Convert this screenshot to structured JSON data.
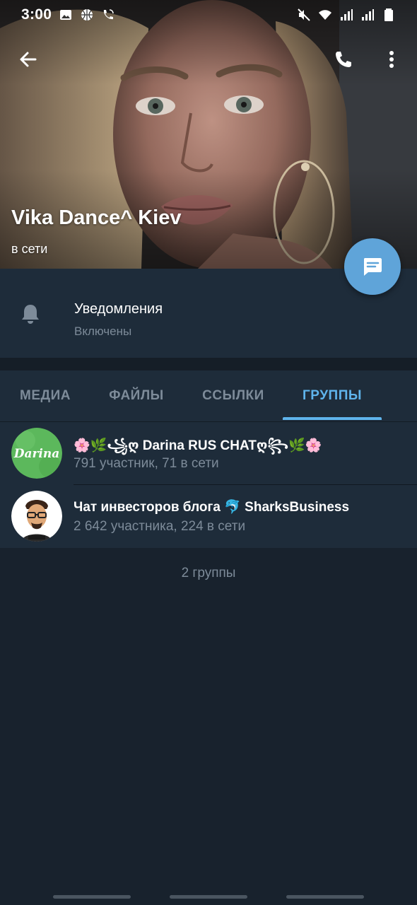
{
  "status_bar": {
    "time": "3:00",
    "left_icons": [
      "image-icon",
      "basketball-icon",
      "wifi-call-icon"
    ],
    "right_icons": [
      "mute-icon",
      "wifi-icon",
      "signal-icon",
      "signal-icon",
      "battery-icon"
    ]
  },
  "header": {
    "name": "Vika Dance^ Kiev",
    "status": "в сети",
    "actions": [
      "back-icon",
      "phone-icon",
      "more-vert-icon"
    ]
  },
  "notifications": {
    "title": "Уведомления",
    "state": "Включены"
  },
  "tabs": [
    {
      "label": "МЕДИА",
      "active": false
    },
    {
      "label": "ФАЙЛЫ",
      "active": false
    },
    {
      "label": "ССЫЛКИ",
      "active": false
    },
    {
      "label": "ГРУППЫ",
      "active": true
    }
  ],
  "groups": [
    {
      "title": "🌸🌿꧁ღ Darina RUS CHATღ꧂🌿🌸",
      "subtitle": "791 участник, 71 в сети",
      "avatar_text": "Darina",
      "avatar_color": "#5cb85c"
    },
    {
      "title": "Чат инвесторов блога 🐬 SharksBusiness",
      "subtitle": "2 642 участника, 224 в сети",
      "avatar_color": "#ffffff"
    }
  ],
  "groups_count": "2 группы",
  "colors": {
    "background": "#18222d",
    "panel": "#1e2c3a",
    "accent": "#5fb4ec",
    "fab": "#5fa4d9",
    "muted_text": "#7d8b99"
  }
}
